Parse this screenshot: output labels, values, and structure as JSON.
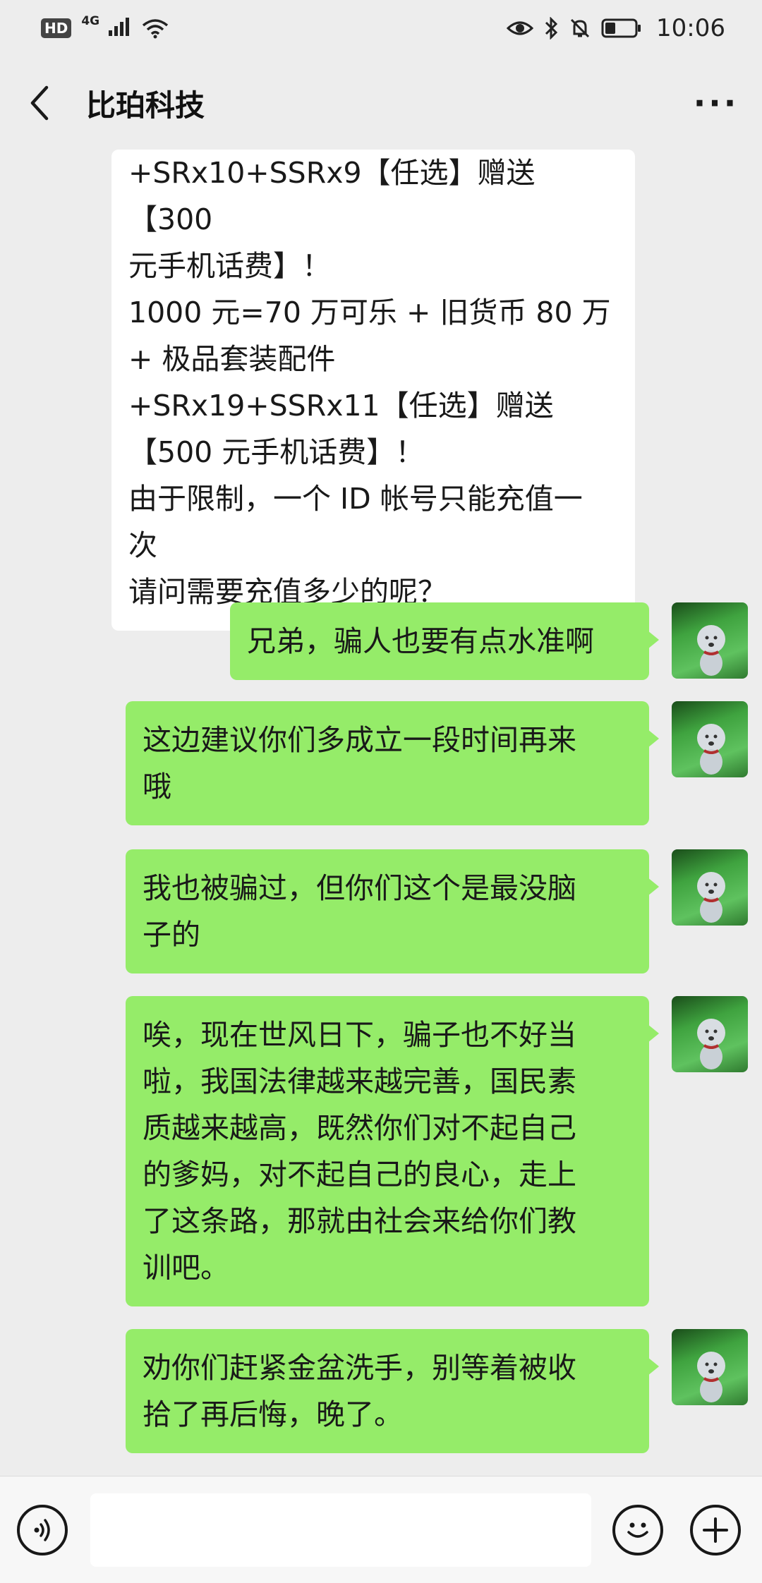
{
  "status_bar": {
    "left_badge": "HD",
    "network": "4G",
    "time": "10:06"
  },
  "header": {
    "title": "比珀科技",
    "more_label": "···"
  },
  "messages": [
    {
      "side": "received",
      "text": "+SRx10+SSRx9【任选】赠送【300\n元手机话费】！\n1000 元=70 万可乐 + 旧货币 80 万\n+ 极品套装配件\n+SRx19+SSRx11【任选】赠送\n【500 元手机话费】！\n由于限制，一个 ID 帐号只能充值一\n次\n请问需要充值多少的呢？"
    },
    {
      "side": "sent",
      "text": "兄弟，骗人也要有点水准啊"
    },
    {
      "side": "sent",
      "text": "这边建议你们多成立一段时间再来\n哦"
    },
    {
      "side": "sent",
      "text": "我也被骗过，但你们这个是最没脑\n子的"
    },
    {
      "side": "sent",
      "text": "唉，现在世风日下，骗子也不好当\n啦，我国法律越来越完善，国民素\n质越来越高，既然你们对不起自己\n的爹妈，对不起自己的良心，走上\n了这条路，那就由社会来给你们教\n训吧。"
    },
    {
      "side": "sent",
      "text": "劝你们赶紧金盆洗手，别等着被收\n拾了再后悔，晚了。"
    }
  ],
  "input_bar": {
    "value": "",
    "voice_icon": "voice-icon",
    "emoji_icon": "emoji-icon",
    "add_icon": "plus-icon"
  },
  "colors": {
    "sent_bubble": "#95ec69",
    "received_bubble": "#ffffff",
    "background": "#ededed"
  }
}
